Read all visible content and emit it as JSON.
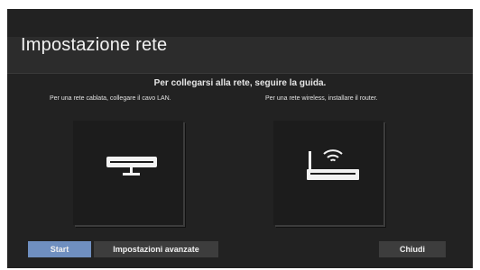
{
  "header": {
    "title": "Impostazione rete"
  },
  "instructions": {
    "main": "Per collegarsi alla rete, seguire la guida.",
    "wired": "Per una rete cablata, collegare il cavo LAN.",
    "wireless": "Per una rete wireless, installare il router."
  },
  "options": [
    {
      "label": "wired",
      "icon": "wired-modem-icon"
    },
    {
      "label": "wireless",
      "icon": "wireless-router-icon"
    }
  ],
  "buttons": {
    "start": "Start",
    "advanced": "Impostazioni avanzate",
    "close": "Chiudi"
  },
  "colors": {
    "background": "#222222",
    "selected_button": "#6f8fc0",
    "button": "#3d3d3d"
  }
}
